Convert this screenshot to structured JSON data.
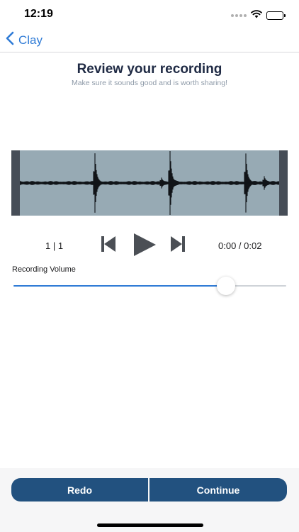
{
  "status_bar": {
    "time": "12:19",
    "icons": [
      "signal-dots-icon",
      "wifi-icon",
      "battery-icon"
    ]
  },
  "nav": {
    "back_label": "Clay",
    "back_icon": "chevron-left-icon"
  },
  "header": {
    "title": "Review your recording",
    "subtitle": "Make sure it sounds good and is worth sharing!"
  },
  "player": {
    "track_counter": "1 | 1",
    "time": "0:00 / 0:02",
    "controls": [
      "skip-previous-icon",
      "play-icon",
      "skip-next-icon"
    ]
  },
  "volume": {
    "label": "Recording Volume",
    "level": 0.78
  },
  "actions": {
    "redo_label": "Redo",
    "continue_label": "Continue"
  },
  "colors": {
    "accent": "#2f7bd6",
    "button": "#22517f",
    "title": "#1f2a44",
    "waveform_bg": "#97aab4",
    "waveform_edge": "#464d57"
  }
}
